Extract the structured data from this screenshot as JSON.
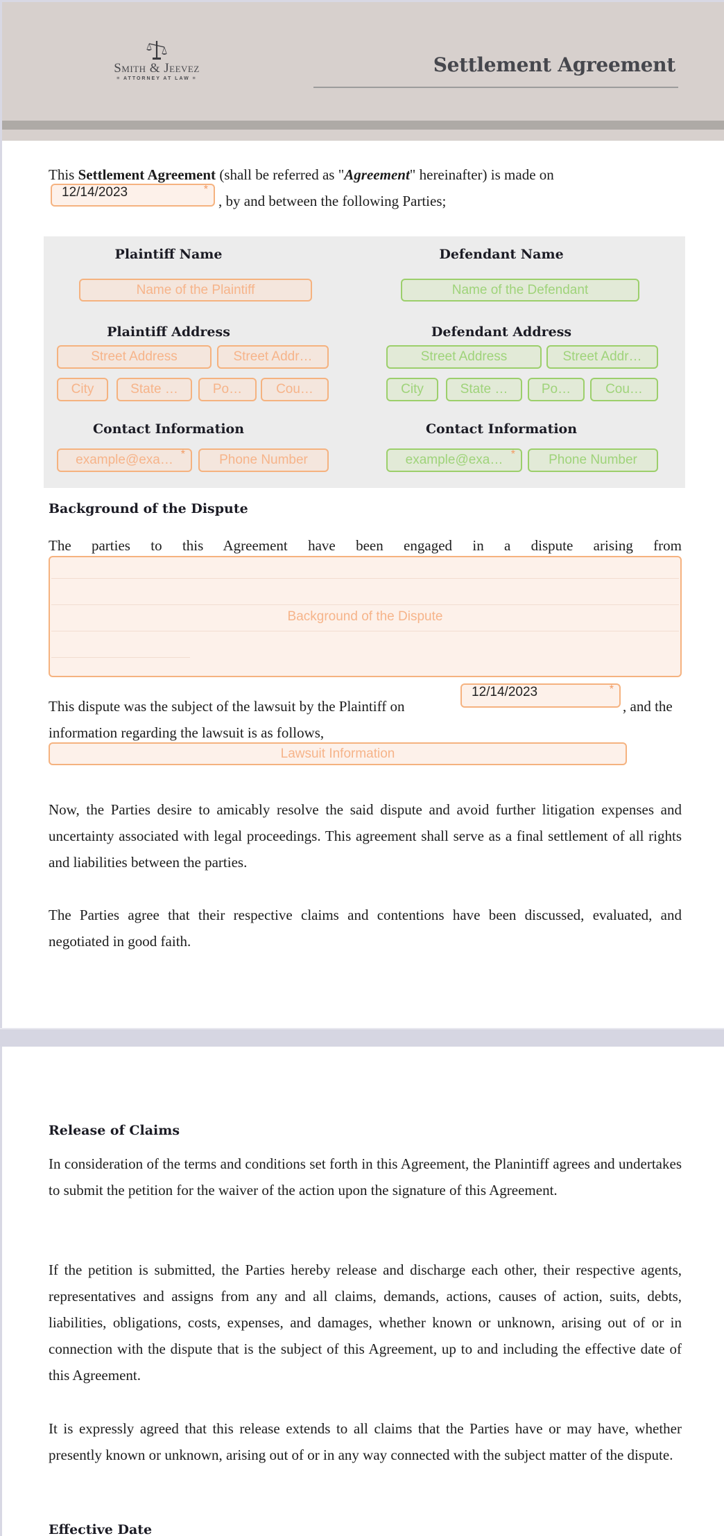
{
  "header": {
    "logo": {
      "icon": "scales-of-justice-icon",
      "firm_name": "Smith & Jeevez",
      "tagline": "= ATTORNEY AT LAW ="
    },
    "title": "Settlement Agreement"
  },
  "intro": {
    "prefix": "This ",
    "bold": "Settlement Agreement",
    "middle": " (shall be referred as \"",
    "italic_bold": "Agreement",
    "suffix": "\" hereinafter) is made on",
    "date_value": "12/14/2023",
    "after_date": ", by and between the following Parties;"
  },
  "plaintiff": {
    "name_heading": "Plaintiff Name",
    "name_placeholder": "Name of the Plaintiff",
    "address_heading": "Plaintiff Address",
    "street1_placeholder": "Street Address",
    "street2_placeholder": "Street Addr…",
    "city_placeholder": "City",
    "state_placeholder": "State …",
    "postal_placeholder": "Po…",
    "country_placeholder": "Cou…",
    "contact_heading": "Contact Information",
    "email_placeholder": "example@exa…",
    "phone_placeholder": "Phone Number"
  },
  "defendant": {
    "name_heading": "Defendant Name",
    "name_placeholder": "Name of the Defendant",
    "address_heading": "Defendant Address",
    "street1_placeholder": "Street Address",
    "street2_placeholder": "Street Addr…",
    "city_placeholder": "City",
    "state_placeholder": "State …",
    "postal_placeholder": "Po…",
    "country_placeholder": "Cou…",
    "contact_heading": "Contact Information",
    "email_placeholder": "example@exa…",
    "phone_placeholder": "Phone Number"
  },
  "background": {
    "heading": "Background of the Dispute",
    "lead": "The parties to this Agreement have been engaged in a dispute arising from",
    "textarea_placeholder": "Background of the Dispute",
    "lawsuit_prefix": "This dispute was the subject of the lawsuit by the Plaintiff on",
    "lawsuit_date_value": "12/14/2023",
    "lawsuit_suffix": ", and the",
    "lawsuit_line2": "information regarding the lawsuit is as follows,",
    "lawsuit_info_placeholder": "Lawsuit Information",
    "para1": "Now, the Parties desire to amicably resolve the said dispute and avoid further litigation expenses and uncertainty associated with legal proceedings. This agreement shall serve as a final settlement of all rights and liabilities between the parties.",
    "para2": "The Parties agree that their respective claims and contentions have been discussed, evaluated, and negotiated in good faith."
  },
  "release": {
    "heading": "Release of Claims",
    "para1": "In consideration of the terms and conditions set forth in this Agreement, the Planintiff agrees and undertakes to submit the petition for the waiver of the action upon the signature of this Agreement.",
    "para2": "If the petition is submitted, the Parties hereby release and discharge each other, their respective agents, representatives and assigns from any and all claims, demands, actions, causes of action, suits, debts, liabilities, obligations, costs, expenses, and damages, whether known or unknown, arising out of or in connection with the dispute that is the subject of this Agreement, up to and including the effective date of this Agreement.",
    "para3": "It is expressly agreed that this release extends to all claims that the Parties have or may have, whether presently known or unknown, arising out of or in any way connected with the subject matter of the dispute."
  },
  "effective_date": {
    "heading": "Effective Date"
  },
  "required_marker": "*",
  "colors": {
    "plaintiff_accent": "#f5b27f",
    "defendant_accent": "#9ccf6b",
    "header_bg": "#d7d0cd"
  }
}
